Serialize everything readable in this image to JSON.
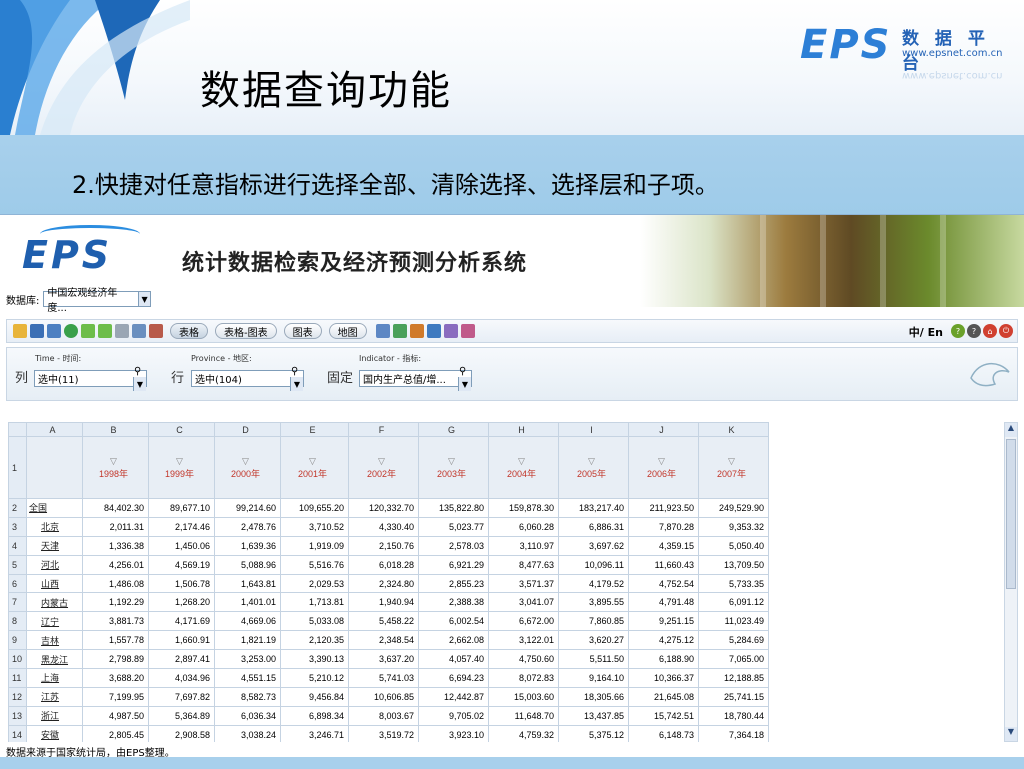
{
  "slide": {
    "title": "数据查询功能",
    "subtitle": "2.快捷对任意指标进行选择全部、清除选择、选择层和子项。"
  },
  "top_logo": {
    "brand": "EPS",
    "name": "数 据 平 台",
    "url": "www.epsnet.com.cn"
  },
  "app": {
    "title": "统计数据检索及经济预测分析系统",
    "logo": "EPS",
    "db_label": "数据库:",
    "db_value": "中国宏观经济年度..."
  },
  "toolbar": {
    "buttons": [
      "表格",
      "表格-图表",
      "图表",
      "地图"
    ],
    "lang": "中/ En"
  },
  "query": {
    "time": {
      "label": "Time - 时间:",
      "prefix": "列",
      "value": "选中(11)"
    },
    "province": {
      "label": "Province - 地区:",
      "prefix": "行",
      "value": "选中(104)"
    },
    "indicator": {
      "label": "Indicator - 指标:",
      "prefix": "固定",
      "value": "国内生产总值/增..."
    }
  },
  "table": {
    "col_letters": [
      "A",
      "B",
      "C",
      "D",
      "E",
      "F",
      "G",
      "H",
      "I",
      "J",
      "K"
    ],
    "years": [
      "1998年",
      "1999年",
      "2000年",
      "2001年",
      "2002年",
      "2003年",
      "2004年",
      "2005年",
      "2006年",
      "2007年"
    ],
    "rows": [
      {
        "n": "2",
        "region": "全国",
        "v": [
          "84,402.30",
          "89,677.10",
          "99,214.60",
          "109,655.20",
          "120,332.70",
          "135,822.80",
          "159,878.30",
          "183,217.40",
          "211,923.50",
          "249,529.90"
        ]
      },
      {
        "n": "3",
        "region": "北京",
        "v": [
          "2,011.31",
          "2,174.46",
          "2,478.76",
          "3,710.52",
          "4,330.40",
          "5,023.77",
          "6,060.28",
          "6,886.31",
          "7,870.28",
          "9,353.32"
        ]
      },
      {
        "n": "4",
        "region": "天津",
        "v": [
          "1,336.38",
          "1,450.06",
          "1,639.36",
          "1,919.09",
          "2,150.76",
          "2,578.03",
          "3,110.97",
          "3,697.62",
          "4,359.15",
          "5,050.40"
        ]
      },
      {
        "n": "5",
        "region": "河北",
        "v": [
          "4,256.01",
          "4,569.19",
          "5,088.96",
          "5,516.76",
          "6,018.28",
          "6,921.29",
          "8,477.63",
          "10,096.11",
          "11,660.43",
          "13,709.50"
        ]
      },
      {
        "n": "6",
        "region": "山西",
        "v": [
          "1,486.08",
          "1,506.78",
          "1,643.81",
          "2,029.53",
          "2,324.80",
          "2,855.23",
          "3,571.37",
          "4,179.52",
          "4,752.54",
          "5,733.35"
        ]
      },
      {
        "n": "7",
        "region": "内蒙古",
        "v": [
          "1,192.29",
          "1,268.20",
          "1,401.01",
          "1,713.81",
          "1,940.94",
          "2,388.38",
          "3,041.07",
          "3,895.55",
          "4,791.48",
          "6,091.12"
        ]
      },
      {
        "n": "8",
        "region": "辽宁",
        "v": [
          "3,881.73",
          "4,171.69",
          "4,669.06",
          "5,033.08",
          "5,458.22",
          "6,002.54",
          "6,672.00",
          "7,860.85",
          "9,251.15",
          "11,023.49"
        ]
      },
      {
        "n": "9",
        "region": "吉林",
        "v": [
          "1,557.78",
          "1,660.91",
          "1,821.19",
          "2,120.35",
          "2,348.54",
          "2,662.08",
          "3,122.01",
          "3,620.27",
          "4,275.12",
          "5,284.69"
        ]
      },
      {
        "n": "10",
        "region": "黑龙江",
        "v": [
          "2,798.89",
          "2,897.41",
          "3,253.00",
          "3,390.13",
          "3,637.20",
          "4,057.40",
          "4,750.60",
          "5,511.50",
          "6,188.90",
          "7,065.00"
        ]
      },
      {
        "n": "11",
        "region": "上海",
        "v": [
          "3,688.20",
          "4,034.96",
          "4,551.15",
          "5,210.12",
          "5,741.03",
          "6,694.23",
          "8,072.83",
          "9,164.10",
          "10,366.37",
          "12,188.85"
        ]
      },
      {
        "n": "12",
        "region": "江苏",
        "v": [
          "7,199.95",
          "7,697.82",
          "8,582.73",
          "9,456.84",
          "10,606.85",
          "12,442.87",
          "15,003.60",
          "18,305.66",
          "21,645.08",
          "25,741.15"
        ]
      },
      {
        "n": "13",
        "region": "浙江",
        "v": [
          "4,987.50",
          "5,364.89",
          "6,036.34",
          "6,898.34",
          "8,003.67",
          "9,705.02",
          "11,648.70",
          "13,437.85",
          "15,742.51",
          "18,780.44"
        ]
      },
      {
        "n": "14",
        "region": "安徽",
        "v": [
          "2,805.45",
          "2,908.58",
          "3,038.24",
          "3,246.71",
          "3,519.72",
          "3,923.10",
          "4,759.32",
          "5,375.12",
          "6,148.73",
          "7,364.18"
        ]
      }
    ]
  },
  "source": "数据来源于国家统计局，由EPS整理。"
}
